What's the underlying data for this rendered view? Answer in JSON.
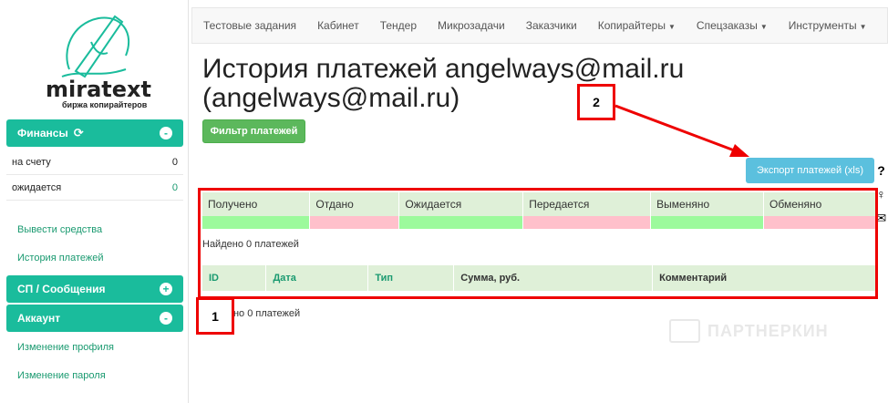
{
  "sidebar": {
    "logo_text": "miratext",
    "logo_sub": "биржа копирайтеров",
    "finance": {
      "title": "Финансы",
      "toggle": "-"
    },
    "rows": [
      {
        "label": "на счету",
        "value": "0"
      },
      {
        "label": "ожидается",
        "value": "0"
      }
    ],
    "links1": [
      "Вывести средства",
      "История платежей"
    ],
    "sp": {
      "title": "СП / Сообщения",
      "toggle": "+"
    },
    "account": {
      "title": "Аккаунт",
      "toggle": "-"
    },
    "links2": [
      "Изменение профиля",
      "Изменение пароля"
    ]
  },
  "nav": {
    "items": [
      {
        "label": "Тестовые задания",
        "caret": ""
      },
      {
        "label": "Кабинет",
        "caret": ""
      },
      {
        "label": "Тендер",
        "caret": ""
      },
      {
        "label": "Микрозадачи",
        "caret": ""
      },
      {
        "label": "Заказчики",
        "caret": ""
      },
      {
        "label": "Копирайтеры",
        "caret": "▼"
      },
      {
        "label": "Спецзаказы",
        "caret": "▼"
      },
      {
        "label": "Инструменты",
        "caret": "▼"
      }
    ]
  },
  "page": {
    "title": "История платежей angelways@mail.ru (angelways@mail.ru)",
    "filter_button": "Фильтр платежей",
    "export_button": "Экспорт платежей (xls)",
    "side_icons": [
      "?",
      "♀",
      "✉"
    ]
  },
  "summary": {
    "columns": [
      "Получено",
      "Отдано",
      "Ожидается",
      "Передается",
      "Выменяно",
      "Обменяно"
    ],
    "colors": [
      "#9cfa9c",
      "#ffc0cb",
      "#9cfa9c",
      "#ffc0cb",
      "#9cfa9c",
      "#ffc0cb"
    ]
  },
  "found_text": "Найдено 0 платежей",
  "found_text_partial": "дено 0 платежей",
  "list": {
    "columns": [
      "ID",
      "Дата",
      "Тип",
      "Сумма, руб.",
      "Комментарий"
    ]
  },
  "annotations": {
    "label1": "1",
    "label2": "2"
  },
  "watermark": "ПАРТНЕРКИН"
}
